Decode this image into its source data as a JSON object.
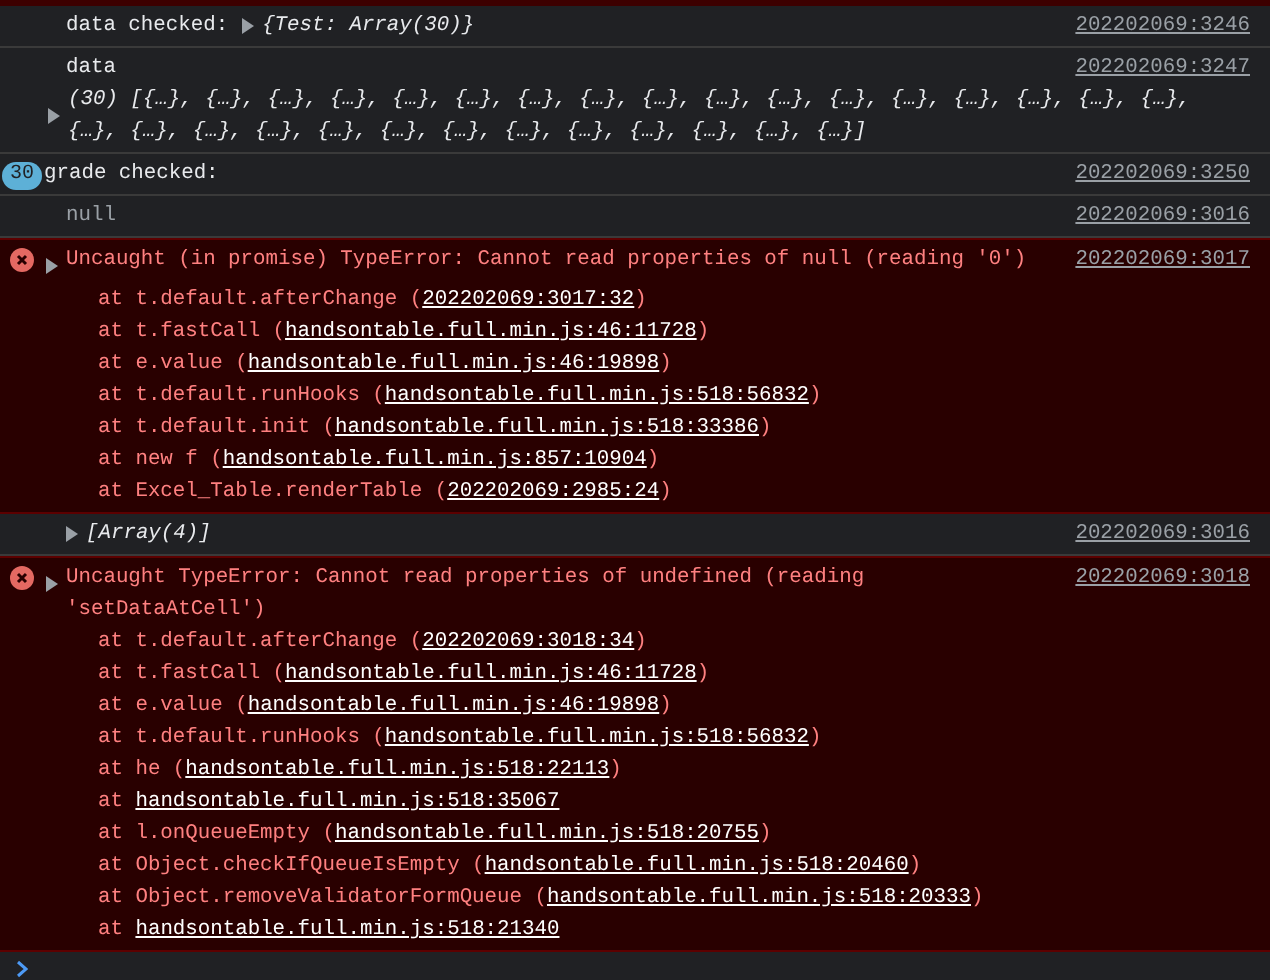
{
  "messages": [
    {
      "kind": "log",
      "text": "data checked:",
      "preview": "{Test: Array(30)}",
      "expanded": false,
      "source": "202202069:3246"
    },
    {
      "kind": "block",
      "text": "data",
      "preview": "(30) [{…}, {…}, {…}, {…}, {…}, {…}, {…}, {…}, {…}, {…}, {…}, {…}, {…}, {…}, {…}, {…}, {…}, {…}, {…}, {…}, {…}, {…}, {…}, {…}, {…}, {…}, {…}, {…}, {…}, {…}]",
      "expanded": false,
      "source": "202202069:3247"
    },
    {
      "kind": "log",
      "count": "30",
      "text": "grade checked:",
      "source": "202202069:3250"
    },
    {
      "kind": "null",
      "text": "null",
      "source": "202202069:3016"
    },
    {
      "kind": "error",
      "text": "Uncaught (in promise) TypeError: Cannot read properties of null (reading '0')",
      "expanded": false,
      "source": "202202069:3017",
      "stack": [
        {
          "before": "at t.default.afterChange (",
          "link": "202202069:3017:32",
          "after": ")"
        },
        {
          "before": "at t.fastCall (",
          "link": "handsontable.full.min.js:46:11728",
          "after": ")"
        },
        {
          "before": "at e.value (",
          "link": "handsontable.full.min.js:46:19898",
          "after": ")"
        },
        {
          "before": "at t.default.runHooks (",
          "link": "handsontable.full.min.js:518:56832",
          "after": ")"
        },
        {
          "before": "at t.default.init (",
          "link": "handsontable.full.min.js:518:33386",
          "after": ")"
        },
        {
          "before": "at new f (",
          "link": "handsontable.full.min.js:857:10904",
          "after": ")"
        },
        {
          "before": "at Excel_Table.renderTable (",
          "link": "202202069:2985:24",
          "after": ")"
        }
      ]
    },
    {
      "kind": "log",
      "preview": "[Array(4)]",
      "expanded": false,
      "source": "202202069:3016"
    },
    {
      "kind": "error",
      "text": "Uncaught TypeError: Cannot read properties of undefined (reading 'setDataAtCell')",
      "expanded": false,
      "source": "202202069:3018",
      "stack": [
        {
          "before": "at t.default.afterChange (",
          "link": "202202069:3018:34",
          "after": ")"
        },
        {
          "before": "at t.fastCall (",
          "link": "handsontable.full.min.js:46:11728",
          "after": ")"
        },
        {
          "before": "at e.value (",
          "link": "handsontable.full.min.js:46:19898",
          "after": ")"
        },
        {
          "before": "at t.default.runHooks (",
          "link": "handsontable.full.min.js:518:56832",
          "after": ")"
        },
        {
          "before": "at he (",
          "link": "handsontable.full.min.js:518:22113",
          "after": ")"
        },
        {
          "before": "at ",
          "link": "handsontable.full.min.js:518:35067"
        },
        {
          "before": "at l.onQueueEmpty (",
          "link": "handsontable.full.min.js:518:20755",
          "after": ")"
        },
        {
          "before": "at Object.checkIfQueueIsEmpty (",
          "link": "handsontable.full.min.js:518:20460",
          "after": ")"
        },
        {
          "before": "at Object.removeValidatorFormQueue (",
          "link": "handsontable.full.min.js:518:20333",
          "after": ")"
        },
        {
          "before": "at ",
          "link": "handsontable.full.min.js:518:21340"
        }
      ]
    }
  ]
}
